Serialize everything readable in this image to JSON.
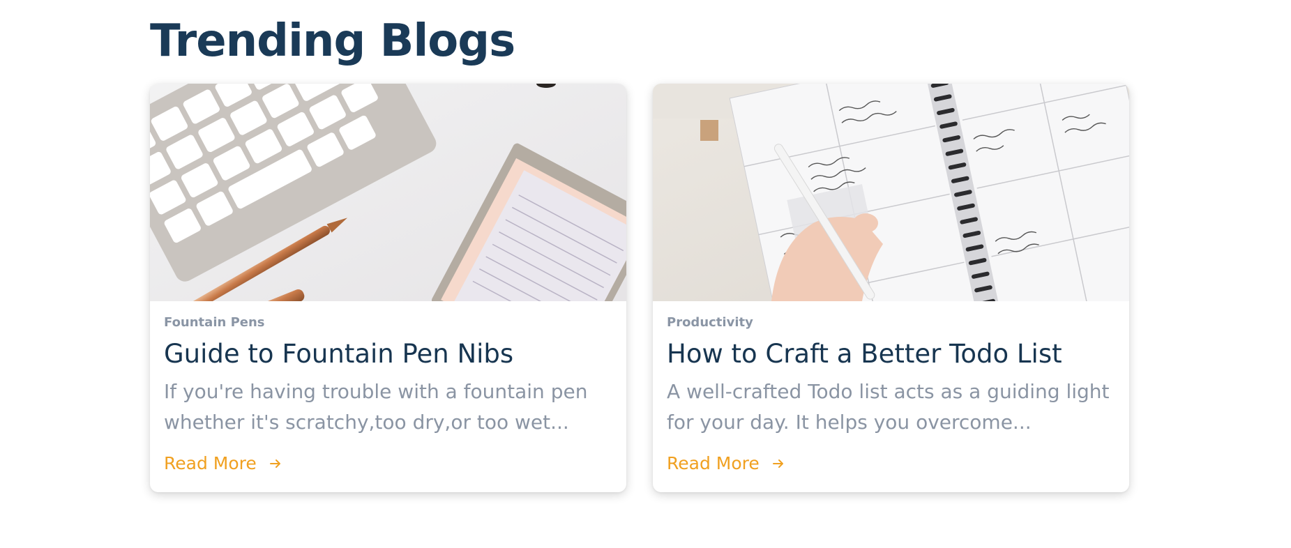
{
  "section": {
    "title": "Trending Blogs"
  },
  "cards": [
    {
      "category": "Fountain Pens",
      "title": "Guide to Fountain Pen Nibs",
      "excerpt": "If you're having trouble with a fountain pen whether it's scratchy,too dry,or too wet...",
      "read_more": "Read More",
      "image": "desk-keyboard-pen-notepad-photo"
    },
    {
      "category": "Productivity",
      "title": "How to Craft a Better Todo List",
      "excerpt": "A well-crafted Todo list acts as a guiding light for your day. It helps you overcome...",
      "read_more": "Read More",
      "image": "hand-writing-planner-photo"
    }
  ],
  "colors": {
    "heading": "#1a3a57",
    "card_title": "#173550",
    "muted_text": "#8a94a3",
    "accent": "#f0a020"
  },
  "icons": {
    "read_more": "arrow-right-icon"
  }
}
